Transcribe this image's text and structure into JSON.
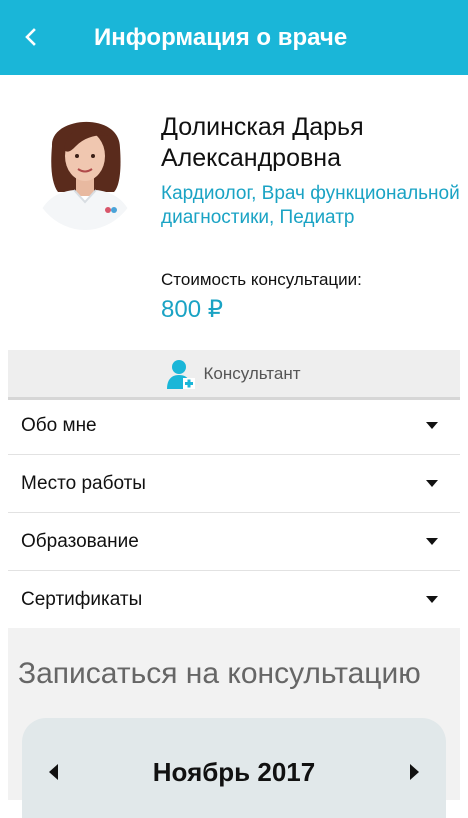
{
  "appbar": {
    "title": "Информация о враче",
    "back_icon": "chevron-left-icon"
  },
  "doctor": {
    "name_line1": "Долинская Дарья",
    "name_line2": "Александровна",
    "specialties": "Кардиолог, Врач функциональной диагностики, Педиатр",
    "price_label": "Стоимость консультации:",
    "price": "800 ₽"
  },
  "consultant": {
    "label": "Консультант",
    "icon": "doctor-icon"
  },
  "sections": [
    {
      "label": "Обо мне"
    },
    {
      "label": "Место работы"
    },
    {
      "label": "Образование"
    },
    {
      "label": "Сертификаты"
    }
  ],
  "booking": {
    "title": "Записаться на консультацию",
    "month": "Ноябрь 2017"
  },
  "colors": {
    "accent": "#1ab6d8",
    "link": "#1aa3c4"
  }
}
